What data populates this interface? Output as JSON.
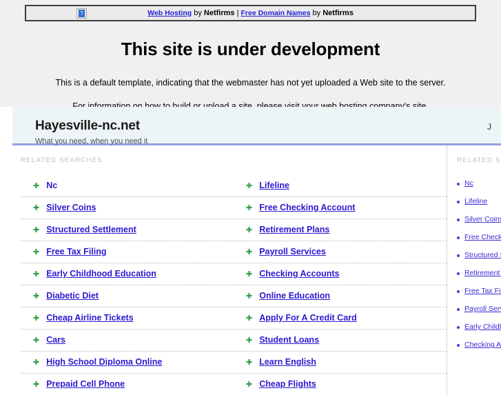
{
  "banner": {
    "broken_image_alt": "?",
    "links": [
      {
        "text": "Web Hosting",
        "type": "link"
      },
      {
        "text": " by ",
        "type": "plain"
      },
      {
        "text": "Netfirms",
        "type": "bold"
      },
      {
        "text": " | ",
        "type": "sep"
      },
      {
        "text": "Free Domain Names",
        "type": "link"
      },
      {
        "text": " by ",
        "type": "plain"
      },
      {
        "text": "Netfirms",
        "type": "bold"
      }
    ],
    "link1": "Web Hosting",
    "by1": " by ",
    "brand1": "Netfirms",
    "separator": " | ",
    "link2": "Free Domain Names",
    "by2": " by ",
    "brand2": "Netfirms"
  },
  "page": {
    "headline": "This site is under development",
    "paragraph1": "This is a default template, indicating that the webmaster has not yet uploaded a Web site to the server.",
    "paragraph2": "For information on how to build or upload a site, please visit your web hosting company's site."
  },
  "parked": {
    "site_title": "Hayesville-nc.net",
    "tagline": "What you need, when you need it",
    "header_right_truncated": "J",
    "related_searches_label": "RELATED SEARCHES",
    "sidebar_label": "RELATED SEARCHES",
    "accent_color": "#8fa2e2",
    "header_bg": "#edf4f6",
    "link_color": "#2b1ad0",
    "marker_color": "#2f9e4f",
    "rows": [
      {
        "left": "Nc",
        "left_underlined": false,
        "right": "Lifeline",
        "right_underlined": true
      },
      {
        "left": "Silver Coins",
        "left_underlined": true,
        "right": "Free Checking Account",
        "right_underlined": true
      },
      {
        "left": "Structured Settlement",
        "left_underlined": true,
        "right": "Retirement Plans",
        "right_underlined": true
      },
      {
        "left": "Free Tax Filing",
        "left_underlined": true,
        "right": "Payroll Services",
        "right_underlined": true
      },
      {
        "left": "Early Childhood Education",
        "left_underlined": true,
        "right": "Checking Accounts",
        "right_underlined": true
      },
      {
        "left": "Diabetic Diet",
        "left_underlined": true,
        "right": "Online Education",
        "right_underlined": true
      },
      {
        "left": "Cheap Airline Tickets",
        "left_underlined": true,
        "right": "Apply For A Credit Card",
        "right_underlined": true
      },
      {
        "left": "Cars",
        "left_underlined": true,
        "right": "Student Loans",
        "right_underlined": true
      },
      {
        "left": "High School Diploma Online",
        "left_underlined": true,
        "right": "Learn English",
        "right_underlined": true
      },
      {
        "left": "Prepaid Cell Phone",
        "left_underlined": true,
        "right": "Cheap Flights",
        "right_underlined": true
      }
    ],
    "sidebar_items": [
      "Nc",
      "Lifeline",
      "Silver Coins",
      "Free Checking Account",
      "Structured Settlement",
      "Retirement Plans",
      "Free Tax Filing",
      "Payroll Services",
      "Early Childhood Education",
      "Checking Accounts"
    ]
  }
}
